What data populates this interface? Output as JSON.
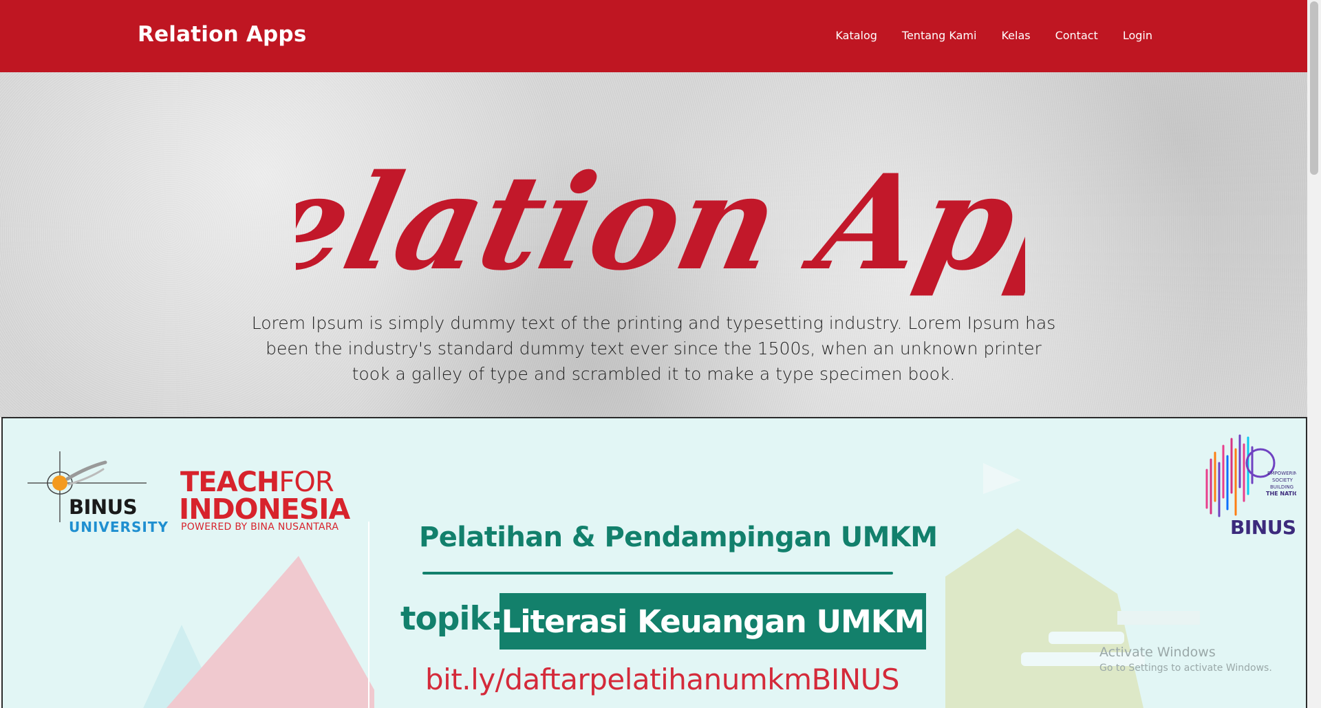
{
  "navbar": {
    "brand": "Relation Apps",
    "links": [
      "Katalog",
      "Tentang Kami",
      "Kelas",
      "Contact",
      "Login"
    ],
    "background": "#bf1622"
  },
  "hero": {
    "logo_text": "Relation Apps",
    "description": "Lorem Ipsum is simply dummy text of the printing and typesetting industry. Lorem Ipsum has been the industry's standard dummy text ever since the 1500s, when an unknown printer took a galley of type and scrambled it to make a type specimen book.",
    "logo_color": "#c2182a"
  },
  "banner": {
    "binus_logo": {
      "word": "BINUS",
      "sub": "UNIVERSITY"
    },
    "tfi_logo": {
      "teach": "TEACH",
      "for": "FOR",
      "indonesia": "INDONESIA",
      "powered": "POWERED BY BINA NUSANTARA"
    },
    "title": "Pelatihan & Pendampingan UMKM",
    "topic_label": "topik:",
    "topic_value": "Literasi Keuangan UMKM",
    "link": "bit.ly/daftarpelatihanumkmBINUS",
    "binus40_logo": {
      "word": "BINUS",
      "tagline": [
        "EMPOWERING",
        "SOCIETY",
        "BUILDING",
        "THE NATION"
      ]
    },
    "accent_green": "#13806b",
    "accent_red": "#d7232c",
    "background": "#e2f6f5"
  },
  "watermark": {
    "title": "Activate Windows",
    "subtitle": "Go to Settings to activate Windows."
  }
}
